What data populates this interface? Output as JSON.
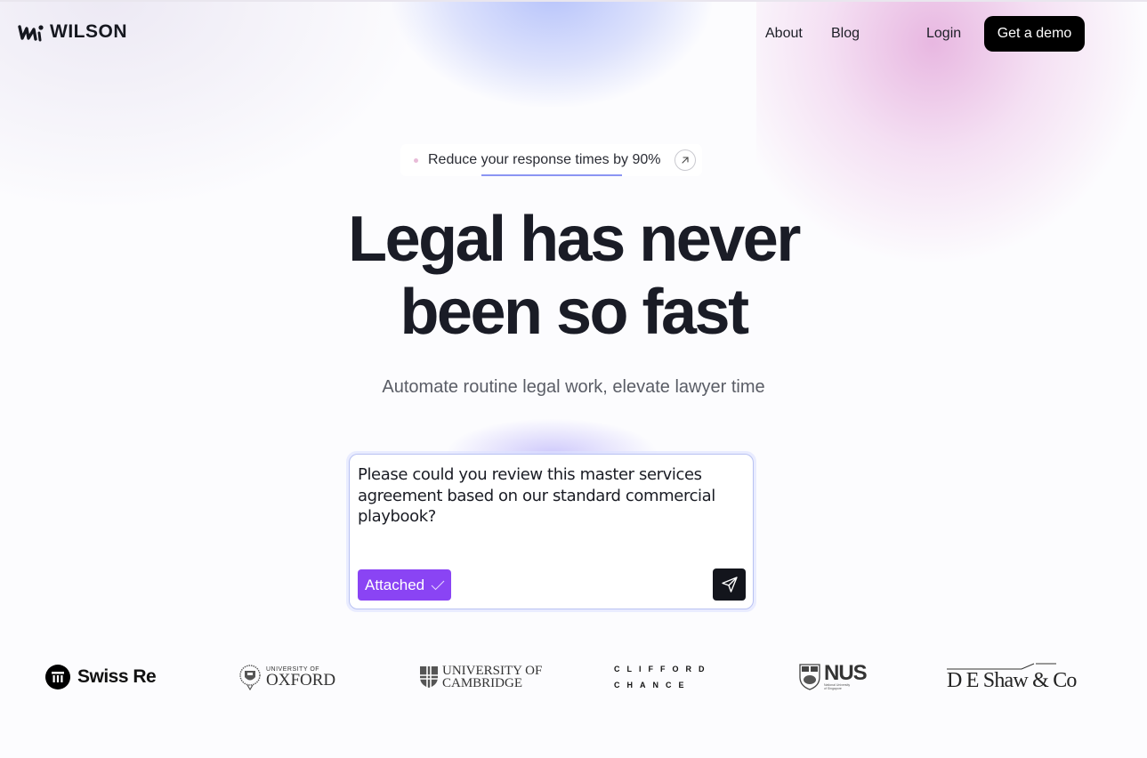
{
  "brand": {
    "name": "WILSON"
  },
  "nav": {
    "about": "About",
    "blog": "Blog",
    "login": "Login",
    "cta": "Get a demo"
  },
  "announcement": {
    "text": "Reduce your response times by 90%",
    "icon": "arrow-up-right-icon"
  },
  "hero": {
    "title_line1": "Legal has never",
    "title_line2": "been so fast",
    "subtitle": "Automate routine legal work, elevate lawyer time"
  },
  "prompt": {
    "text": "Please could you review this master services agreement based on our standard commercial playbook?",
    "attached_label": "Attached",
    "attached_icon": "check-icon",
    "send_icon": "send-icon"
  },
  "clients": {
    "swiss_re": "Swiss Re",
    "oxford_small": "UNIVERSITY OF",
    "oxford_big": "OXFORD",
    "cambridge_line1": "UNIVERSITY OF",
    "cambridge_line2": "CAMBRIDGE",
    "clifford_line1": "CLIFFORD",
    "clifford_line2": "CHANCE",
    "nus_big": "NUS",
    "nus_line1": "National University",
    "nus_line2": "of Singapore",
    "deshaw": "D E Shaw & Co"
  },
  "colors": {
    "accent_purple": "#8a44f4",
    "cta_black": "#000000",
    "send_button": "#13151c",
    "input_border": "#b9c2f2"
  }
}
